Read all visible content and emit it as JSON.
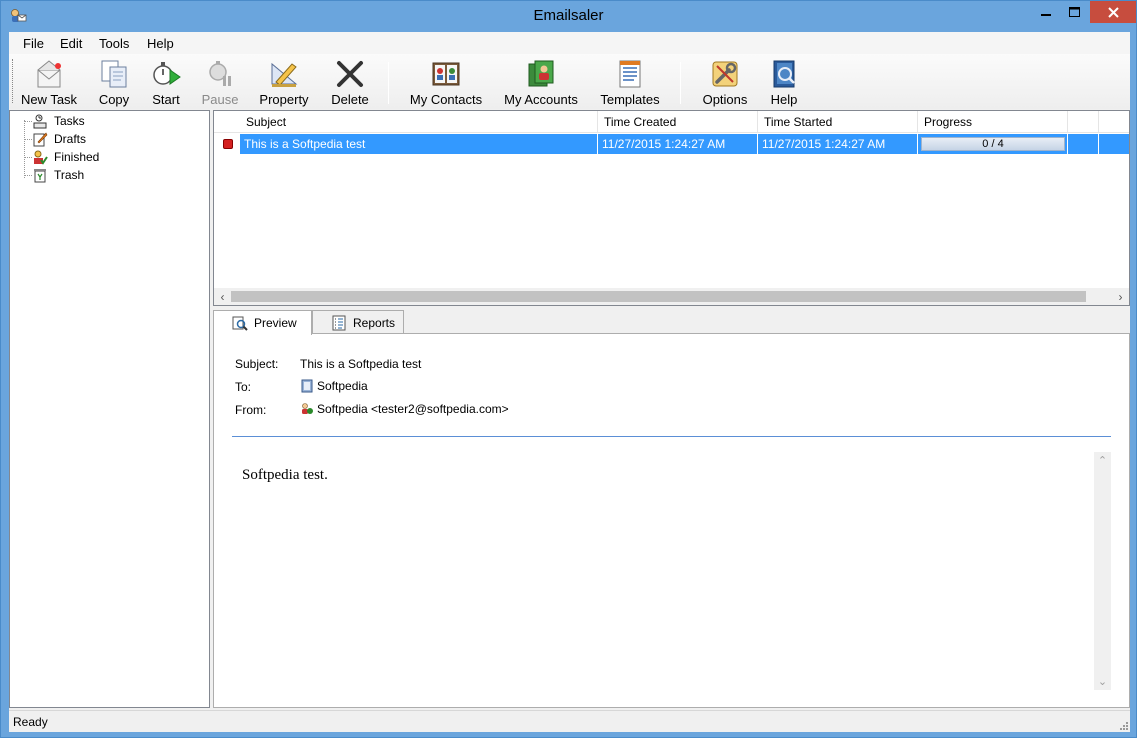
{
  "window": {
    "title": "Emailsaler"
  },
  "menu": [
    {
      "label": "File"
    },
    {
      "label": "Edit"
    },
    {
      "label": "Tools"
    },
    {
      "label": "Help"
    }
  ],
  "toolbar": {
    "new_task": "New Task",
    "copy": "Copy",
    "start": "Start",
    "pause": "Pause",
    "property": "Property",
    "delete": "Delete",
    "my_contacts": "My Contacts",
    "my_accounts": "My Accounts",
    "templates": "Templates",
    "options": "Options",
    "help": "Help"
  },
  "tree": [
    {
      "label": "Tasks",
      "icon": "tasks-icon"
    },
    {
      "label": "Drafts",
      "icon": "drafts-icon"
    },
    {
      "label": "Finished",
      "icon": "finished-icon"
    },
    {
      "label": "Trash",
      "icon": "trash-icon"
    }
  ],
  "task_list": {
    "columns": [
      "Subject",
      "Time Created",
      "Time Started",
      "Progress"
    ],
    "rows": [
      {
        "subject": "This is a Softpedia test",
        "time_created": "11/27/2015 1:24:27 AM",
        "time_started": "11/27/2015 1:24:27 AM",
        "progress_text": "0 / 4",
        "progress_fraction": 0.0
      }
    ]
  },
  "tabs": [
    {
      "label": "Preview"
    },
    {
      "label": "Reports"
    }
  ],
  "preview": {
    "subject_label": "Subject:",
    "subject_value": "This is a Softpedia test",
    "to_label": "To:",
    "to_value": "Softpedia",
    "from_label": "From:",
    "from_value": "Softpedia <tester2@softpedia.com>",
    "body": "Softpedia test."
  },
  "status": {
    "text": "Ready"
  },
  "colors": {
    "selection": "#3399ff",
    "title_bar": "#6aa5dd",
    "close_button": "#c74d3e"
  }
}
